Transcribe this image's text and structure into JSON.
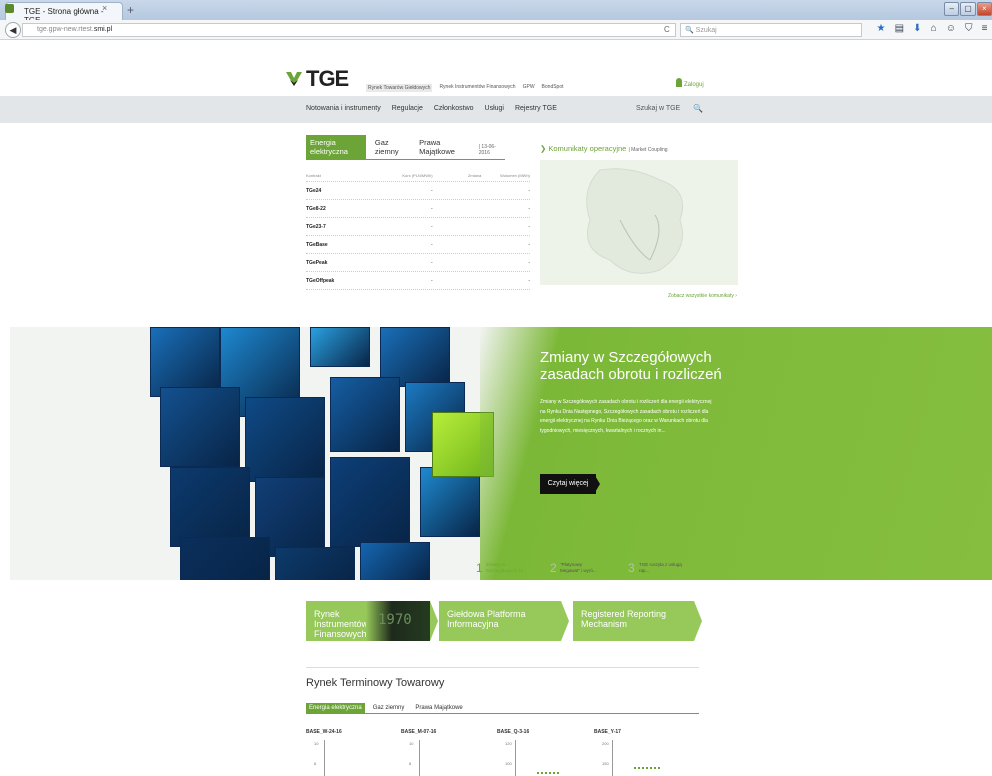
{
  "browser": {
    "tab_title": "TGE - Strona główna - TGE",
    "tab_close": "×",
    "new_tab": "+",
    "url_prefix": "tge.gpw-new.rtest.",
    "url_domain": "smi.pl",
    "reload": "C",
    "search_placeholder": "Szukaj",
    "window_buttons": [
      "–",
      "▢",
      "×"
    ]
  },
  "header": {
    "logo": "TGE",
    "top_nav": [
      "Rynek Towarów Giełdowych",
      "Rynek Instrumentów Finansowych",
      "GPW",
      "BondSpot"
    ],
    "login": "Zaloguj"
  },
  "main_nav": {
    "items": [
      "Notowania i instrumenty",
      "Regulacje",
      "Członkostwo",
      "Usługi",
      "Rejestry TGE"
    ],
    "search": "Szukaj w TGE"
  },
  "quotes": {
    "tabs": [
      "Energia elektryczna",
      "Gaz ziemny",
      "Prawa Majątkowe"
    ],
    "date": "| 13-06-2016",
    "columns": [
      "Kontrakt",
      "Kurs (PLN/MWh)",
      "Zmiana",
      "Wolumen (MWh)"
    ],
    "rows": [
      [
        "TGe24",
        "-",
        "",
        "-"
      ],
      [
        "TGe8-22",
        "-",
        "",
        "-"
      ],
      [
        "TGe23-7",
        "-",
        "",
        "-"
      ],
      [
        "TGeBase",
        "-",
        "",
        "-"
      ],
      [
        "TGePeak",
        "-",
        "",
        "-"
      ],
      [
        "TGeOffpeak",
        "-",
        "",
        "-"
      ]
    ]
  },
  "komunikaty": {
    "title": "Komunikaty operacyjne",
    "sub": "| Market Coupling",
    "all": "Zobacz wszystkie komunikaty ›"
  },
  "hero": {
    "title": "Zmiany w Szczegółowych zasadach obrotu i rozliczeń",
    "text": "Zmiany w Szczegółowych zasadach obrotu i rozliczeń dla energii elektrycznej na Rynku Dnia Następnego, Szczegółowych zasadach obrotu i rozliczeń dla energii elektrycznej na Rynku Dnia Bieżącego oraz w Warunkach obrotu dla tygodniowych, miesięcznych, kwartalnych i rocznych in...",
    "button": "Czytaj więcej",
    "slides": [
      {
        "num": "1",
        "label": "Zmiany w Szczegółowych za..."
      },
      {
        "num": "2",
        "label": "\"Platynowy Megawat\" i wyró..."
      },
      {
        "num": "3",
        "label": "TGE ruszyła z usługą rap..."
      }
    ]
  },
  "boxes": [
    {
      "label": "Rynek Instrumentów Finansowych",
      "img_text": "1970"
    },
    {
      "label": "Giełdowa Platforma Informacyjna"
    },
    {
      "label": "Registered Reporting Mechanism"
    }
  ],
  "rtt": {
    "title": "Rynek Terminowy Towarowy",
    "tabs": [
      "Energia elektryczna",
      "Gaz ziemny",
      "Prawa Majątkowe"
    ],
    "charts": [
      "BASE_W-24-16",
      "BASE_M-07-16",
      "BASE_Q-3-16",
      "BASE_Y-17"
    ],
    "ticks": [
      [
        "10",
        "8"
      ],
      [
        "10",
        "8"
      ],
      [
        "120",
        "100"
      ],
      [
        "200",
        "150"
      ]
    ]
  },
  "colors": {
    "brand_green": "#6ca437",
    "box_green": "#96c85a",
    "cube_blue": "#1a6fb8"
  }
}
